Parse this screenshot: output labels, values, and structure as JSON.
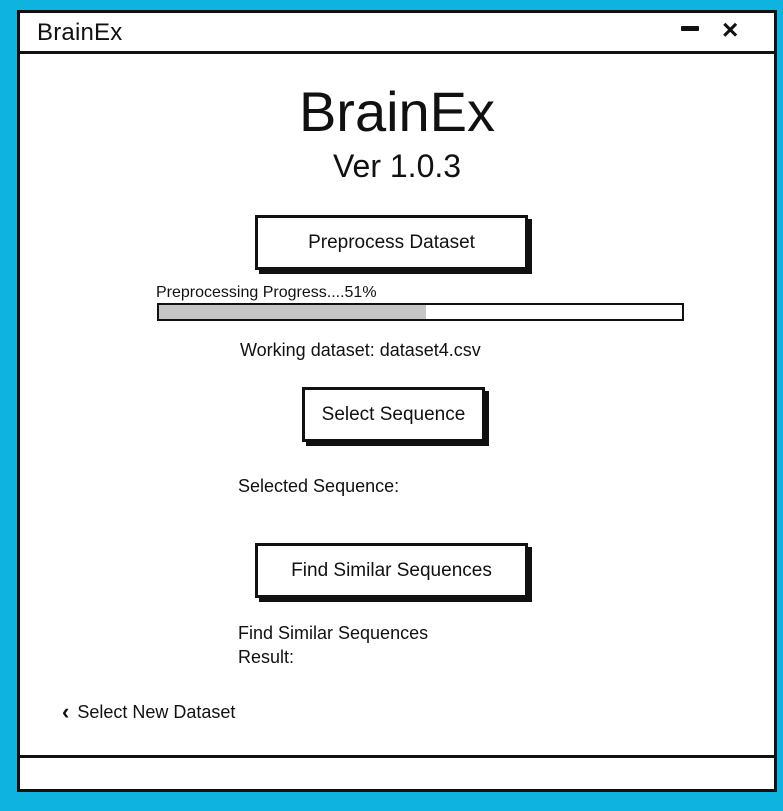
{
  "window": {
    "title": "BrainEx",
    "minimize_icon": "minimize-icon",
    "close_icon": "close-icon",
    "close_glyph": "×"
  },
  "header": {
    "app_name": "BrainEx",
    "version": "Ver 1.0.3"
  },
  "preprocess": {
    "button_label": "Preprocess Dataset",
    "progress_label": "Preprocessing Progress....51%",
    "progress_percent": 51,
    "progress_fill_color": "#c6c6c6"
  },
  "dataset": {
    "working_text": "Working dataset: dataset4.csv"
  },
  "sequence": {
    "button_label": "Select Sequence",
    "selected_text": "Selected Sequence:"
  },
  "similar": {
    "button_label": "Find Similar Sequences",
    "result_text": "Find Similar Sequences Result:"
  },
  "navigation": {
    "back_icon": "chevron-left-icon",
    "back_glyph": "‹",
    "back_label": "Select New Dataset"
  },
  "colors": {
    "background": "#0fb3df",
    "window": "#ffffff",
    "border": "#111111"
  }
}
